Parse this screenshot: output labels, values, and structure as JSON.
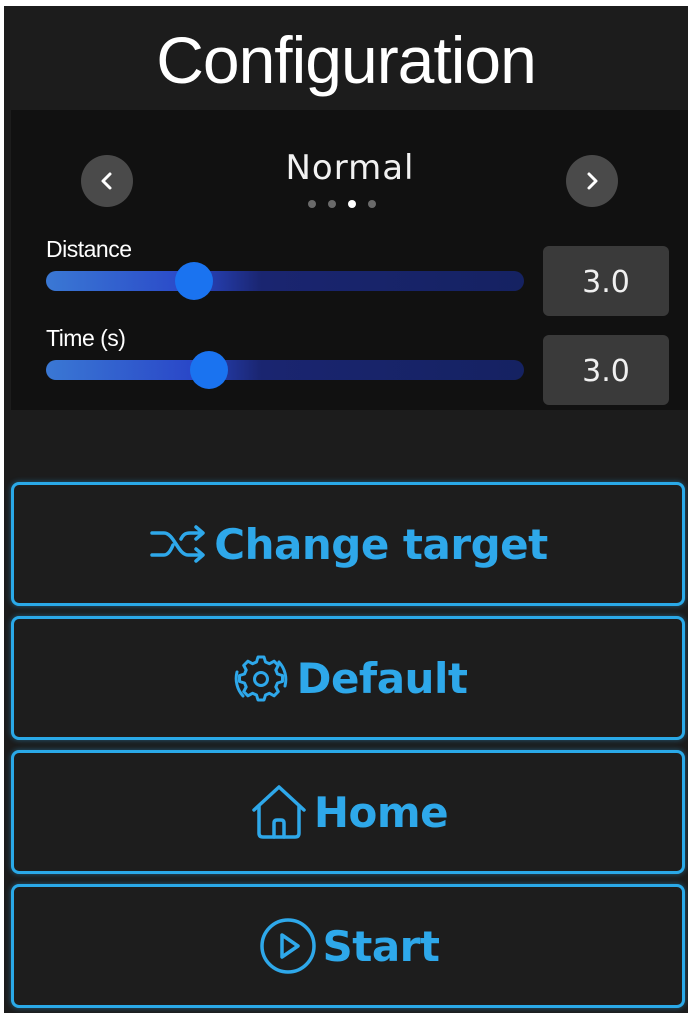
{
  "header": {
    "title": "Configuration"
  },
  "mode_selector": {
    "current": "Normal",
    "page_count": 4,
    "active_page_index": 2
  },
  "sliders": [
    {
      "label": "Distance",
      "value": "3.0",
      "fill_fraction": 0.31
    },
    {
      "label": "Time (s)",
      "value": "3.0",
      "fill_fraction": 0.34
    }
  ],
  "actions": [
    {
      "label": "Change target",
      "icon": "shuffle-icon"
    },
    {
      "label": "Default",
      "icon": "gear-icon"
    },
    {
      "label": "Home",
      "icon": "home-icon"
    },
    {
      "label": "Start",
      "icon": "play-circle-icon"
    }
  ],
  "colors": {
    "background": "#1c1c1c",
    "panel": "#111111",
    "accent": "#2ea8ea",
    "slider_thumb": "#1a73f0",
    "value_box": "#3a3a3a"
  }
}
